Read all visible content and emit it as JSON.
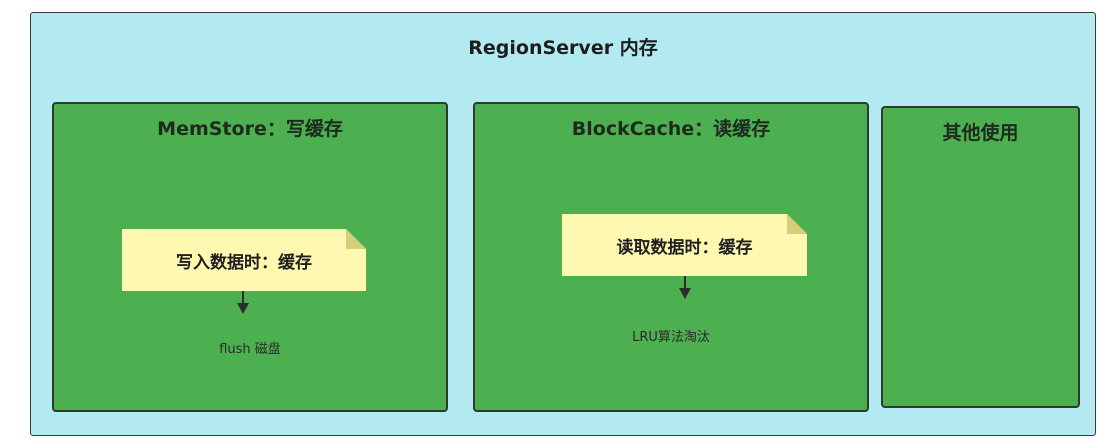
{
  "diagram": {
    "outer_title": "RegionServer 内存",
    "memstore": {
      "title": "MemStore：写缓存",
      "note": "写入数据时：缓存",
      "caption": "flush 磁盘"
    },
    "blockcache": {
      "title": "BlockCache：读缓存",
      "note": "读取数据时：缓存",
      "caption": "LRU算法淘汰"
    },
    "other": {
      "title": "其他使用"
    }
  },
  "colors": {
    "outer_fill": "#b3eaf2",
    "box_fill": "#4caf50",
    "note_fill": "#fff8b0",
    "note_fold": "#d6cf78"
  }
}
